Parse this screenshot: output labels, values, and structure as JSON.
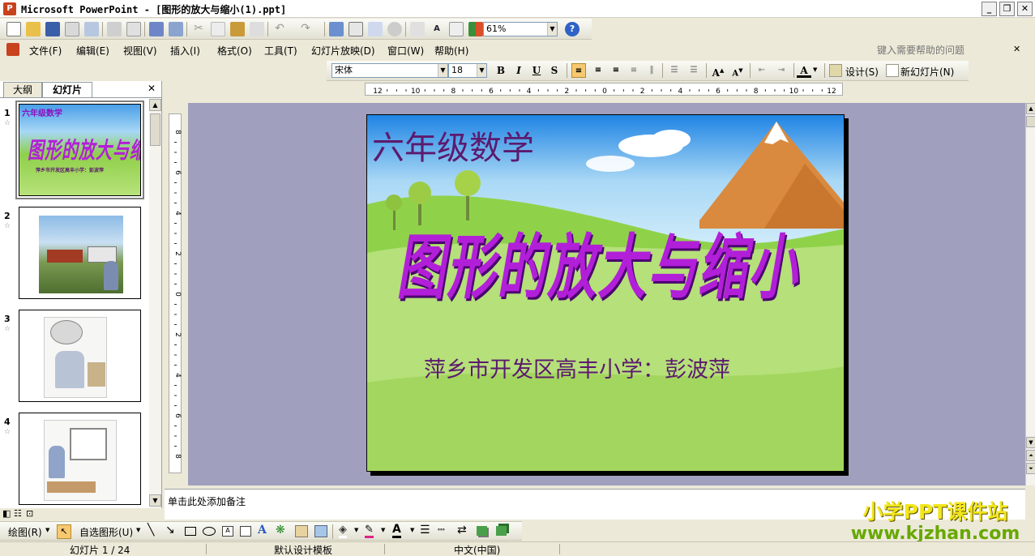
{
  "window": {
    "title": "Microsoft PowerPoint - [图形的放大与缩小(1).ppt]"
  },
  "menu": {
    "items": [
      "文件(F)",
      "编辑(E)",
      "视图(V)",
      "插入(I)",
      "格式(O)",
      "工具(T)",
      "幻灯片放映(D)",
      "窗口(W)",
      "帮助(H)"
    ],
    "help_placeholder": "键入需要帮助的问题"
  },
  "standard_toolbar": {
    "zoom": "61%"
  },
  "format_toolbar": {
    "font": "宋体",
    "size": "18",
    "design_label": "设计(S)",
    "new_slide_label": "新幻灯片(N)"
  },
  "pane_tabs": [
    "大纲",
    "幻灯片"
  ],
  "slide": {
    "grade_text": "六年级数学",
    "title_text": "图形的放大与缩小",
    "author_text": "萍乡市开发区高丰小学：彭波萍"
  },
  "thumbnails": [
    {
      "number": "1",
      "title": "六年级数学",
      "heading": "图形的放大与缩小",
      "caption": "萍乡市开发区高丰小学：彭波萍"
    },
    {
      "number": "2"
    },
    {
      "number": "3"
    },
    {
      "number": "4"
    }
  ],
  "notes_placeholder": "单击此处添加备注",
  "drawing_toolbar": {
    "draw_label": "绘图(R)",
    "autoshapes_label": "自选图形(U)"
  },
  "status": {
    "slide_count": "幻灯片 1 / 24",
    "design": "默认设计模板",
    "language": "中文(中国)"
  },
  "watermark": {
    "line1": "小学PPT课件站",
    "line2": "www.kjzhan.com"
  },
  "ruler": {
    "horizontal": [
      "12",
      "10",
      "8",
      "6",
      "4",
      "2",
      "0",
      "2",
      "4",
      "6",
      "8",
      "10",
      "12"
    ],
    "vertical": [
      "8",
      "6",
      "4",
      "2",
      "0",
      "2",
      "4",
      "6",
      "8"
    ]
  },
  "colors": {
    "title_text": "#8d0fbf",
    "slide_text": "#5c1a6e",
    "accent": "#0a246a",
    "watermark_yellow": "#f2e61a",
    "watermark_green": "#67a800"
  }
}
